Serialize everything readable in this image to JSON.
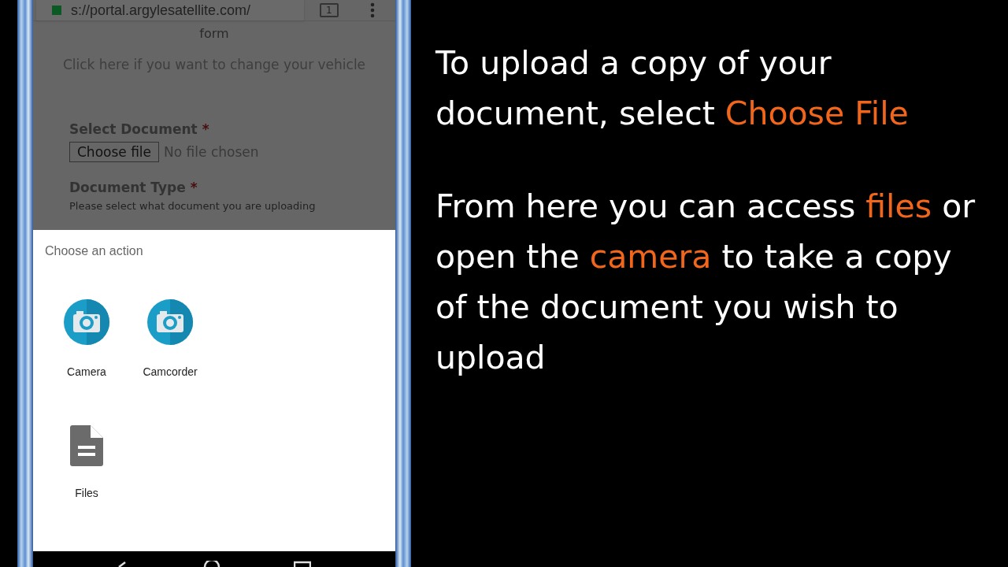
{
  "browser": {
    "url": "s://portal.argylesatellite.com/",
    "tab_count": "1"
  },
  "page": {
    "heading_tail": "form",
    "change_vehicle_link": "Click here if you want to change your vehicle",
    "fields": [
      {
        "kind": "file",
        "label": "Select Document",
        "required_mark": "*",
        "button": "Choose file",
        "status": "No file chosen"
      },
      {
        "kind": "select",
        "label": "Document Type",
        "required_mark": "*",
        "help": "Please select what document you are uploading"
      }
    ]
  },
  "action_sheet": {
    "title": "Choose an action",
    "apps": [
      {
        "kind": "camera",
        "label": "Camera"
      },
      {
        "kind": "camera",
        "label": "Camcorder"
      },
      {
        "kind": "file",
        "label": "Files"
      }
    ]
  },
  "captions": [
    [
      {
        "text": "To upload a copy of your document, select ",
        "highlight": false
      },
      {
        "text": "Choose File",
        "highlight": true
      }
    ],
    [
      {
        "text": "From here you can access ",
        "highlight": false
      },
      {
        "text": "files",
        "highlight": true
      },
      {
        "text": " or open the ",
        "highlight": false
      },
      {
        "text": "camera",
        "highlight": true
      },
      {
        "text": " to take a copy of the document you wish to upload",
        "highlight": false
      }
    ]
  ]
}
